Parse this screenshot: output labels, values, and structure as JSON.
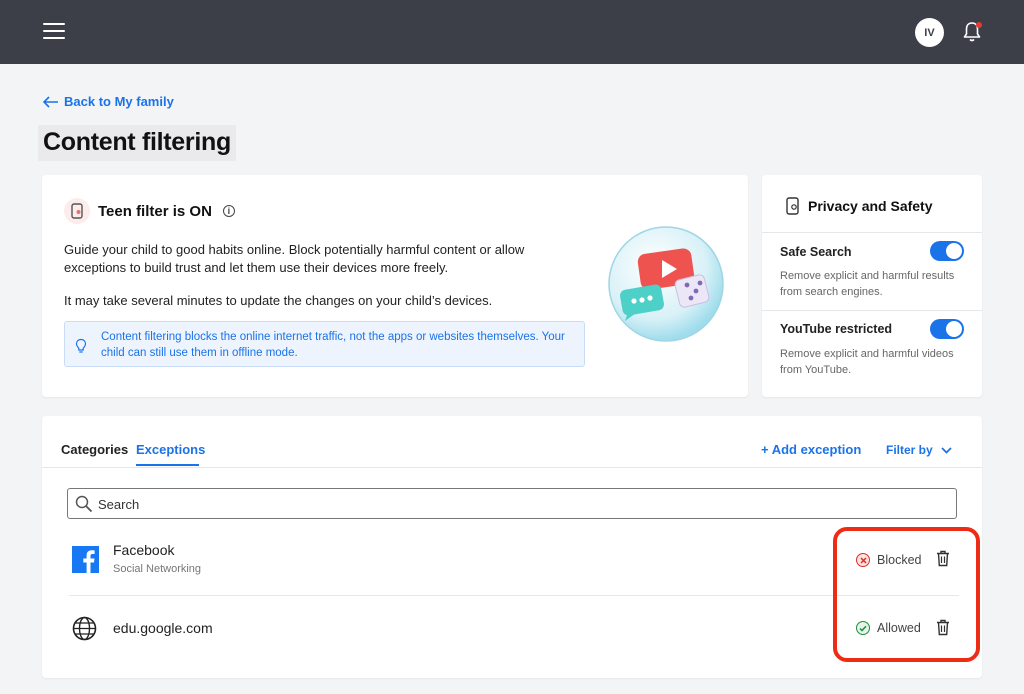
{
  "topbar": {
    "menu_icon": "hamburger-menu-icon",
    "avatar_initials": "IV",
    "bell_icon": "bell-icon",
    "notification_dot_color": "#e53935"
  },
  "nav": {
    "back_label": "Back to My family"
  },
  "page": {
    "title": "Content filtering"
  },
  "filter_card": {
    "title": "Teen filter is ON",
    "description": "Guide your child to good habits online. Block potentially harmful content or allow exceptions to build trust and let them use their devices more freely.",
    "update_note": "It may take several minutes to update the changes on your child’s devices.",
    "notice": "Content filtering blocks the online internet traffic, not the apps or websites themselves. Your child can still use them in offline mode."
  },
  "privacy_card": {
    "title": "Privacy and Safety",
    "settings": [
      {
        "title": "Safe Search",
        "description": "Remove explicit and harmful results from search engines.",
        "enabled": true
      },
      {
        "title": "YouTube restricted",
        "description": "Remove explicit and harmful videos from YouTube.",
        "enabled": true
      }
    ]
  },
  "list": {
    "tabs": [
      "Categories",
      "Exceptions"
    ],
    "active_tab": "Exceptions",
    "add_exception": "+ Add exception",
    "filter_by": "Filter by",
    "search_placeholder": "Search",
    "rows": [
      {
        "name": "Facebook",
        "category": "Social Networking",
        "status": "Blocked",
        "status_color": "#d93025",
        "icon": "facebook-icon"
      },
      {
        "name": "edu.google.com",
        "category": "",
        "status": "Allowed",
        "status_color": "#1e8e3e",
        "icon": "globe-icon"
      }
    ]
  },
  "colors": {
    "accent": "#1a73e8",
    "topbar": "#3c3f47",
    "highlight": "#ee2b14"
  }
}
